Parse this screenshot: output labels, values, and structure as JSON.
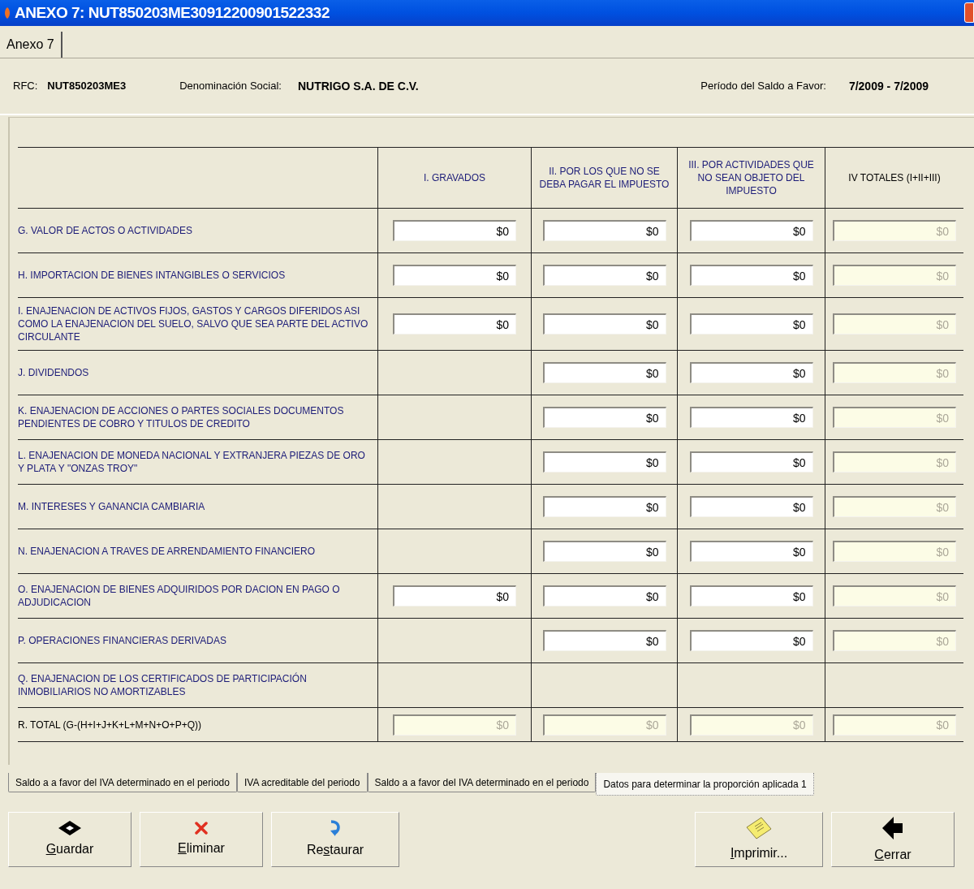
{
  "window": {
    "title": "ANEXO 7: NUT850203ME30912200901522332"
  },
  "top_tabs": [
    {
      "label": "Anexo 7",
      "selected": true
    }
  ],
  "info": {
    "rfc_label": "RFC:",
    "rfc": "NUT850203ME3",
    "name_label": "Denominación Social:",
    "name": "NUTRIGO S.A. DE C.V.",
    "period_label": "Período del Saldo a Favor:",
    "period": "7/2009 - 7/2009"
  },
  "table": {
    "columns": [
      {
        "label": "I. GRAVADOS",
        "kind": "category"
      },
      {
        "label": "II. POR LOS QUE NO SE DEBA PAGAR EL IMPUESTO",
        "kind": "category"
      },
      {
        "label": "III. POR ACTIVIDADES QUE NO SEAN OBJETO DEL IMPUESTO",
        "kind": "category"
      },
      {
        "label": "IV TOTALES (I+II+III)",
        "kind": "total"
      }
    ],
    "rows": [
      {
        "label": "G. VALOR DE ACTOS O ACTIVIDADES",
        "cells": [
          {
            "value": "$0",
            "disabled": false
          },
          {
            "value": "$0",
            "disabled": false
          },
          {
            "value": "$0",
            "disabled": false
          },
          {
            "value": "$0",
            "disabled": true
          }
        ]
      },
      {
        "label": "H. IMPORTACION DE BIENES INTANGIBLES O SERVICIOS",
        "cells": [
          {
            "value": "$0",
            "disabled": false
          },
          {
            "value": "$0",
            "disabled": false
          },
          {
            "value": "$0",
            "disabled": false
          },
          {
            "value": "$0",
            "disabled": true
          }
        ]
      },
      {
        "label": "I. ENAJENACION DE ACTIVOS FIJOS, GASTOS Y CARGOS DIFERIDOS ASI COMO LA ENAJENACION DEL SUELO, SALVO QUE SEA PARTE DEL ACTIVO CIRCULANTE",
        "cells": [
          {
            "value": "$0",
            "disabled": false
          },
          {
            "value": "$0",
            "disabled": false
          },
          {
            "value": "$0",
            "disabled": false
          },
          {
            "value": "$0",
            "disabled": true
          }
        ]
      },
      {
        "label": "J. DIVIDENDOS",
        "cells": [
          null,
          {
            "value": "$0",
            "disabled": false
          },
          {
            "value": "$0",
            "disabled": false
          },
          {
            "value": "$0",
            "disabled": true
          }
        ]
      },
      {
        "label": "K. ENAJENACION DE ACCIONES O PARTES SOCIALES DOCUMENTOS PENDIENTES DE COBRO Y TITULOS DE CREDITO",
        "cells": [
          null,
          {
            "value": "$0",
            "disabled": false
          },
          {
            "value": "$0",
            "disabled": false
          },
          {
            "value": "$0",
            "disabled": true
          }
        ]
      },
      {
        "label": "L. ENAJENACION DE MONEDA NACIONAL Y EXTRANJERA PIEZAS DE ORO Y PLATA Y \"ONZAS TROY\"",
        "cells": [
          null,
          {
            "value": "$0",
            "disabled": false
          },
          {
            "value": "$0",
            "disabled": false
          },
          {
            "value": "$0",
            "disabled": true
          }
        ]
      },
      {
        "label": "M. INTERESES Y GANANCIA CAMBIARIA",
        "cells": [
          null,
          {
            "value": "$0",
            "disabled": false
          },
          {
            "value": "$0",
            "disabled": false
          },
          {
            "value": "$0",
            "disabled": true
          }
        ]
      },
      {
        "label": "N. ENAJENACION A TRAVES DE ARRENDAMIENTO FINANCIERO",
        "cells": [
          null,
          {
            "value": "$0",
            "disabled": false
          },
          {
            "value": "$0",
            "disabled": false
          },
          {
            "value": "$0",
            "disabled": true
          }
        ]
      },
      {
        "label": "O. ENAJENACION DE BIENES ADQUIRIDOS POR DACION EN PAGO O ADJUDICACION",
        "cells": [
          {
            "value": "$0",
            "disabled": false
          },
          {
            "value": "$0",
            "disabled": false
          },
          {
            "value": "$0",
            "disabled": false
          },
          {
            "value": "$0",
            "disabled": true
          }
        ]
      },
      {
        "label": "P. OPERACIONES FINANCIERAS DERIVADAS",
        "cells": [
          null,
          {
            "value": "$0",
            "disabled": false
          },
          {
            "value": "$0",
            "disabled": false
          },
          {
            "value": "$0",
            "disabled": true
          }
        ]
      },
      {
        "label": "Q. ENAJENACION DE LOS CERTIFICADOS DE PARTICIPACIÓN INMOBILIARIOS NO AMORTIZABLES",
        "cells": [
          null,
          null,
          null,
          null
        ]
      },
      {
        "label": "R. TOTAL (G-(H+I+J+K+L+M+N+O+P+Q))",
        "kind": "total",
        "cells": [
          {
            "value": "$0",
            "disabled": true
          },
          {
            "value": "$0",
            "disabled": true
          },
          {
            "value": "$0",
            "disabled": true
          },
          {
            "value": "$0",
            "disabled": true
          }
        ]
      }
    ]
  },
  "bottom_tabs": [
    {
      "label": "Saldo a a favor del IVA determinado en el periodo",
      "selected": false
    },
    {
      "label": "IVA acreditable del periodo",
      "selected": false
    },
    {
      "label": "Saldo a a favor del IVA determinado en el periodo",
      "selected": false
    },
    {
      "label": "Datos para determinar la proporción aplicada 1",
      "selected": true
    }
  ],
  "buttons": [
    {
      "access_key": "G",
      "label_rest": "uardar",
      "kind": "save"
    },
    {
      "access_key": "E",
      "label_rest": "liminar",
      "kind": "delete"
    },
    {
      "label_start": "Re",
      "access_key": "s",
      "label_rest": "taurar",
      "kind": "restore"
    },
    {
      "access_key": "I",
      "label_rest": "mprimir...",
      "kind": "print"
    },
    {
      "access_key": "C",
      "label_rest": "errar",
      "kind": "close"
    }
  ]
}
